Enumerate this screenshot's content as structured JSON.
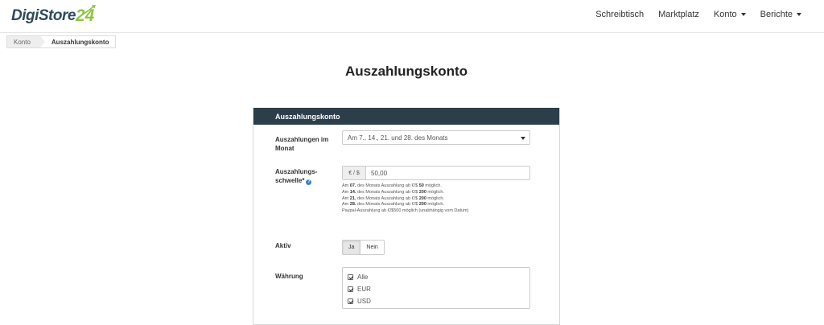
{
  "header": {
    "logo_text": "DigiStore",
    "logo_number": "24",
    "nav": [
      {
        "label": "Schreibtisch",
        "dropdown": false
      },
      {
        "label": "Marktplatz",
        "dropdown": false
      },
      {
        "label": "Konto",
        "dropdown": true
      },
      {
        "label": "Berichte",
        "dropdown": true
      }
    ]
  },
  "breadcrumb": [
    "Konto",
    "Auszahlungskonto"
  ],
  "page_title": "Auszahlungskonto",
  "panel": {
    "title": "Auszahlungskonto",
    "payouts_label": "Auszahlungen im Monat",
    "payouts_value": "Am 7., 14., 21. und 28. des Monats",
    "threshold_label_1": "Auszahlungs-",
    "threshold_label_2": "schwelle*",
    "threshold_addon": "€ / $",
    "threshold_value": "50,00",
    "help_lines": [
      {
        "pre": "Am ",
        "bold": "07.",
        "post": " des Monats Auszahlung ab €/$ ",
        "amount": "50",
        "suffix": " möglich."
      },
      {
        "pre": "Am ",
        "bold": "14.",
        "post": " des Monats Auszahlung ab €/$ ",
        "amount": "200",
        "suffix": " möglich."
      },
      {
        "pre": "Am ",
        "bold": "21.",
        "post": " des Monats Auszahlung ab €/$ ",
        "amount": "200",
        "suffix": " möglich."
      },
      {
        "pre": "Am ",
        "bold": "28.",
        "post": " des Monats Auszahlung ab €/$ ",
        "amount": "200",
        "suffix": " möglich."
      }
    ],
    "paypal_note": "Paypal-Auszahlung ab €/$500 möglich (unabhängig vom Datum)",
    "active_label": "Aktiv",
    "active_options": [
      "Ja",
      "Nein"
    ],
    "currency_label": "Währung",
    "currency_options": [
      {
        "label": "Alle",
        "checked": true
      },
      {
        "label": "EUR",
        "checked": true
      },
      {
        "label": "USD",
        "checked": true
      }
    ]
  },
  "colors": {
    "panel_header_bg": "#2c3e4a",
    "logo_green": "#8cc63f",
    "logo_dark": "#2e4b5b",
    "help_icon": "#3a84c4"
  }
}
